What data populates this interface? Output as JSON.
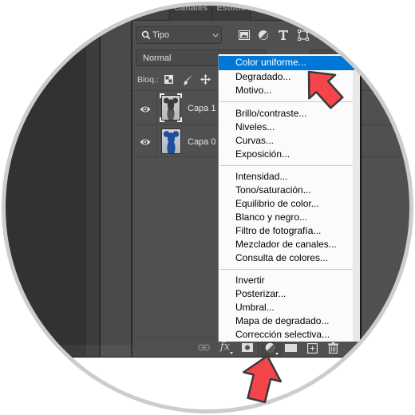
{
  "panel": {
    "tabs": [
      {
        "label": "Canales"
      },
      {
        "label": "Estilos"
      }
    ]
  },
  "filter": {
    "kind_label": "Tipo",
    "icons": [
      "image-filter-icon",
      "adjustment-filter-icon",
      "type-filter-icon",
      "shape-filter-icon"
    ]
  },
  "blend_mode": {
    "value": "Normal"
  },
  "lock": {
    "label": "Bloq.:",
    "icons": [
      "lock-transparent-pixels-icon",
      "lock-image-pixels-icon",
      "lock-position-icon"
    ]
  },
  "layers": [
    {
      "name": "Capa 1",
      "visible": true,
      "thumbnail": "grayscale teddy bear",
      "selected": true
    },
    {
      "name": "Capa 0",
      "visible": true,
      "thumbnail": "blue teddy bear",
      "selected": false
    }
  ],
  "toolbar": {
    "buttons": [
      {
        "icon": "link-layers-icon"
      },
      {
        "icon": "fx-icon",
        "label": "fx"
      },
      {
        "icon": "add-mask-icon"
      },
      {
        "icon": "new-adjustment-layer-icon",
        "active": true
      },
      {
        "icon": "new-group-icon"
      },
      {
        "icon": "new-layer-icon"
      },
      {
        "icon": "delete-layer-icon"
      }
    ]
  },
  "adjustment_menu": {
    "highlighted": "Color uniforme...",
    "groups": [
      {
        "items": [
          {
            "label": "Color uniforme..."
          },
          {
            "label": "Degradado..."
          },
          {
            "label": "Motivo..."
          }
        ]
      },
      {
        "items": [
          {
            "label": "Brillo/contraste..."
          },
          {
            "label": "Niveles..."
          },
          {
            "label": "Curvas..."
          },
          {
            "label": "Exposición..."
          }
        ]
      },
      {
        "items": [
          {
            "label": "Intensidad..."
          },
          {
            "label": "Tono/saturación..."
          },
          {
            "label": "Equilibrio de color..."
          },
          {
            "label": "Blanco y negro..."
          },
          {
            "label": "Filtro de fotografía..."
          },
          {
            "label": "Mezclador de canales..."
          },
          {
            "label": "Consulta de colores..."
          }
        ]
      },
      {
        "items": [
          {
            "label": "Invertir"
          },
          {
            "label": "Posterizar..."
          },
          {
            "label": "Umbral..."
          },
          {
            "label": "Mapa de degradado..."
          },
          {
            "label": "Corrección selectiva..."
          }
        ]
      }
    ]
  },
  "annotations": [
    {
      "type": "arrow",
      "points_to": "Color uniforme..."
    },
    {
      "type": "arrow",
      "points_to": "new-adjustment-layer-button"
    }
  ],
  "colors": {
    "highlight": "#0078d7",
    "arrow": "#f4454a",
    "panel_bg": "#505050",
    "workspace_bg": "#323232"
  }
}
